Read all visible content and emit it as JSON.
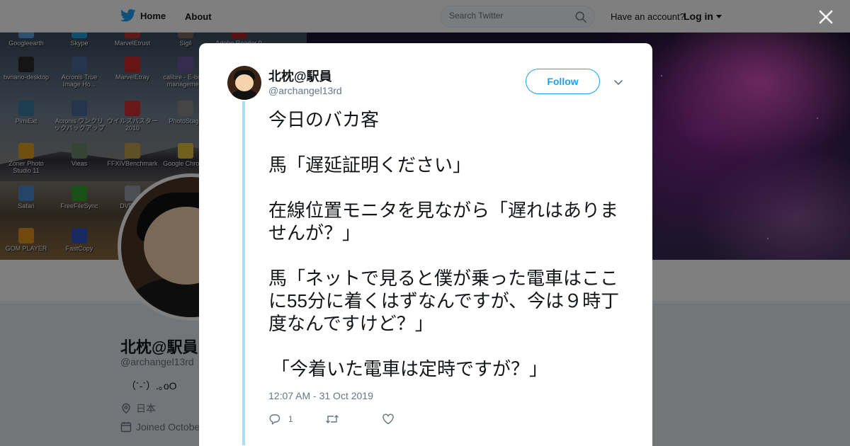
{
  "colors": {
    "twitter_blue": "#1da1f2",
    "thread_line": "#aadcf8",
    "text_primary": "#14171a",
    "text_secondary": "#657786"
  },
  "topbar": {
    "home_label": "Home",
    "about_label": "About",
    "search_placeholder": "Search Twitter",
    "account_question": "Have an account?",
    "login_label": "Log in"
  },
  "desktop_icons": [
    {
      "label": "Googleearth",
      "color": "#5aa0e0"
    },
    {
      "label": "Skype",
      "color": "#1ea0e0"
    },
    {
      "label": "MarvelEtrust",
      "color": "#c03030"
    },
    {
      "label": "Sigil",
      "color": "#7a6a5a"
    },
    {
      "label": "Adobe Reader 9",
      "color": "#b02020"
    },
    {
      "label": "bvnano-desktop",
      "color": "#2a2a2a"
    },
    {
      "label": "Acronis True Image Ho...",
      "color": "#4a6a9a"
    },
    {
      "label": "MarvelEtray",
      "color": "#cc2a2a"
    },
    {
      "label": "calibre - E-book management",
      "color": "#6a5aa0"
    },
    {
      "label": "PimiExt",
      "color": "#3a7aa0"
    },
    {
      "label": "Acronis ワンクリックバックアップ",
      "color": "#4a6a9a"
    },
    {
      "label": "ウイルスバスター2010",
      "color": "#d03030"
    },
    {
      "label": "PhotoStage",
      "color": "#8a8a8a"
    },
    {
      "label": "Zoner Photo Studio 11",
      "color": "#e0a020"
    },
    {
      "label": "Vieas",
      "color": "#6a8a6a"
    },
    {
      "label": "FFXIVBenchmark",
      "color": "#c0a050"
    },
    {
      "label": "Google Chrome",
      "color": "#e0c040"
    },
    {
      "label": "Safari",
      "color": "#4a8ad0"
    },
    {
      "label": "FreeFileSync",
      "color": "#30a030"
    },
    {
      "label": "DVD D...",
      "color": "#9a9aaa"
    },
    {
      "label": "GOM PLAYER",
      "color": "#e09020"
    },
    {
      "label": "FastCopy",
      "color": "#3050c0"
    }
  ],
  "profile": {
    "name": "北枕@駅員",
    "handle": "@archangel13rd",
    "bio": "（´-`）.｡oO",
    "location": "日本",
    "joined": "Joined Octobe"
  },
  "tweet": {
    "author_name": "北枕@駅員",
    "author_handle": "@archangel13rd",
    "follow_label": "Follow",
    "paragraphs": [
      "今日のバカ客",
      "馬「遅延証明ください」",
      "在線位置モニタを見ながら「遅れはありませんが？」",
      "馬「ネットで見ると僕が乗った電車はここに55分に着くはずなんですが、今は９時丁度なんですけど？」",
      "「今着いた電車は定時ですが？」"
    ],
    "timestamp": "12:07 AM - 31 Oct 2019",
    "reply_count": "1",
    "retweet_count": "",
    "like_count": ""
  }
}
